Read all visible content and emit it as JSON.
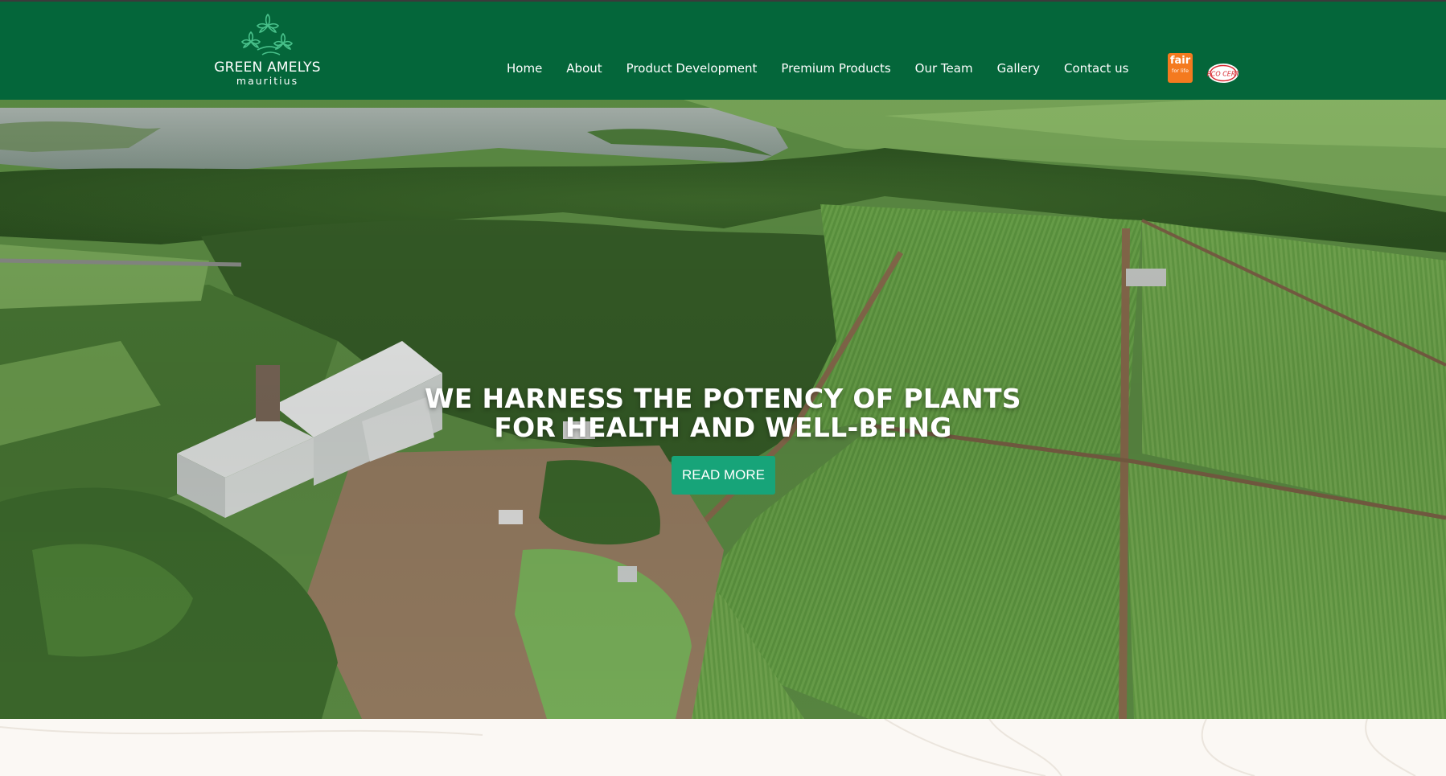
{
  "brand": {
    "name": "GREEN AMELYS",
    "sub": "mauritius",
    "logo_icon": "frangipani-flowers-icon"
  },
  "nav": {
    "items": [
      {
        "label": "Home"
      },
      {
        "label": "About"
      },
      {
        "label": "Product Development"
      },
      {
        "label": "Premium Products"
      },
      {
        "label": "Our Team"
      },
      {
        "label": "Gallery"
      },
      {
        "label": "Contact us"
      }
    ]
  },
  "certifications": {
    "fair_for_life": {
      "line1": "fair",
      "line2": "for life"
    },
    "ecocert": {
      "label": "ECO CERT"
    }
  },
  "hero": {
    "title_line1": "WE HARNESS THE POTENCY OF PLANTS",
    "title_line2": "FOR HEALTH AND WELL-BEING",
    "button_label": "READ MORE"
  },
  "colors": {
    "header_bg": "#04663a",
    "button_bg": "#17a479",
    "fair_badge": "#f47a1f",
    "page_bg": "#fbf8f4"
  }
}
